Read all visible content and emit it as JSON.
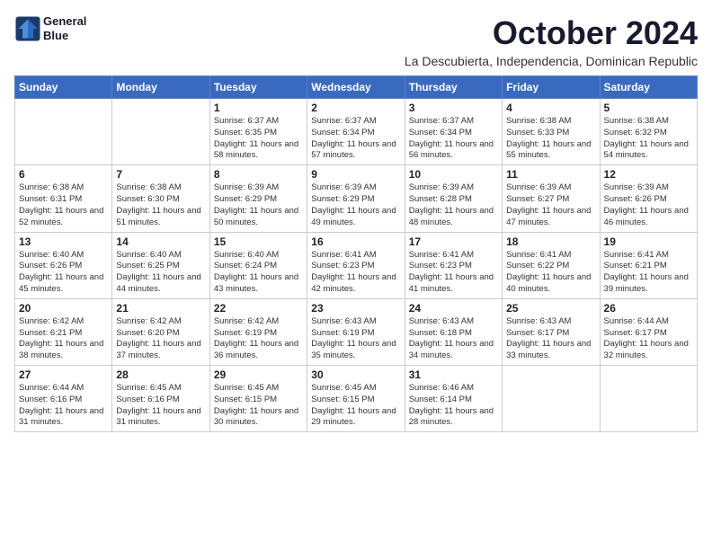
{
  "logo": {
    "line1": "General",
    "line2": "Blue"
  },
  "title": "October 2024",
  "location": "La Descubierta, Independencia, Dominican Republic",
  "weekdays": [
    "Sunday",
    "Monday",
    "Tuesday",
    "Wednesday",
    "Thursday",
    "Friday",
    "Saturday"
  ],
  "weeks": [
    [
      {
        "day": "",
        "sunrise": "",
        "sunset": "",
        "daylight": ""
      },
      {
        "day": "",
        "sunrise": "",
        "sunset": "",
        "daylight": ""
      },
      {
        "day": "1",
        "sunrise": "Sunrise: 6:37 AM",
        "sunset": "Sunset: 6:35 PM",
        "daylight": "Daylight: 11 hours and 58 minutes."
      },
      {
        "day": "2",
        "sunrise": "Sunrise: 6:37 AM",
        "sunset": "Sunset: 6:34 PM",
        "daylight": "Daylight: 11 hours and 57 minutes."
      },
      {
        "day": "3",
        "sunrise": "Sunrise: 6:37 AM",
        "sunset": "Sunset: 6:34 PM",
        "daylight": "Daylight: 11 hours and 56 minutes."
      },
      {
        "day": "4",
        "sunrise": "Sunrise: 6:38 AM",
        "sunset": "Sunset: 6:33 PM",
        "daylight": "Daylight: 11 hours and 55 minutes."
      },
      {
        "day": "5",
        "sunrise": "Sunrise: 6:38 AM",
        "sunset": "Sunset: 6:32 PM",
        "daylight": "Daylight: 11 hours and 54 minutes."
      }
    ],
    [
      {
        "day": "6",
        "sunrise": "Sunrise: 6:38 AM",
        "sunset": "Sunset: 6:31 PM",
        "daylight": "Daylight: 11 hours and 52 minutes."
      },
      {
        "day": "7",
        "sunrise": "Sunrise: 6:38 AM",
        "sunset": "Sunset: 6:30 PM",
        "daylight": "Daylight: 11 hours and 51 minutes."
      },
      {
        "day": "8",
        "sunrise": "Sunrise: 6:39 AM",
        "sunset": "Sunset: 6:29 PM",
        "daylight": "Daylight: 11 hours and 50 minutes."
      },
      {
        "day": "9",
        "sunrise": "Sunrise: 6:39 AM",
        "sunset": "Sunset: 6:29 PM",
        "daylight": "Daylight: 11 hours and 49 minutes."
      },
      {
        "day": "10",
        "sunrise": "Sunrise: 6:39 AM",
        "sunset": "Sunset: 6:28 PM",
        "daylight": "Daylight: 11 hours and 48 minutes."
      },
      {
        "day": "11",
        "sunrise": "Sunrise: 6:39 AM",
        "sunset": "Sunset: 6:27 PM",
        "daylight": "Daylight: 11 hours and 47 minutes."
      },
      {
        "day": "12",
        "sunrise": "Sunrise: 6:39 AM",
        "sunset": "Sunset: 6:26 PM",
        "daylight": "Daylight: 11 hours and 46 minutes."
      }
    ],
    [
      {
        "day": "13",
        "sunrise": "Sunrise: 6:40 AM",
        "sunset": "Sunset: 6:26 PM",
        "daylight": "Daylight: 11 hours and 45 minutes."
      },
      {
        "day": "14",
        "sunrise": "Sunrise: 6:40 AM",
        "sunset": "Sunset: 6:25 PM",
        "daylight": "Daylight: 11 hours and 44 minutes."
      },
      {
        "day": "15",
        "sunrise": "Sunrise: 6:40 AM",
        "sunset": "Sunset: 6:24 PM",
        "daylight": "Daylight: 11 hours and 43 minutes."
      },
      {
        "day": "16",
        "sunrise": "Sunrise: 6:41 AM",
        "sunset": "Sunset: 6:23 PM",
        "daylight": "Daylight: 11 hours and 42 minutes."
      },
      {
        "day": "17",
        "sunrise": "Sunrise: 6:41 AM",
        "sunset": "Sunset: 6:23 PM",
        "daylight": "Daylight: 11 hours and 41 minutes."
      },
      {
        "day": "18",
        "sunrise": "Sunrise: 6:41 AM",
        "sunset": "Sunset: 6:22 PM",
        "daylight": "Daylight: 11 hours and 40 minutes."
      },
      {
        "day": "19",
        "sunrise": "Sunrise: 6:41 AM",
        "sunset": "Sunset: 6:21 PM",
        "daylight": "Daylight: 11 hours and 39 minutes."
      }
    ],
    [
      {
        "day": "20",
        "sunrise": "Sunrise: 6:42 AM",
        "sunset": "Sunset: 6:21 PM",
        "daylight": "Daylight: 11 hours and 38 minutes."
      },
      {
        "day": "21",
        "sunrise": "Sunrise: 6:42 AM",
        "sunset": "Sunset: 6:20 PM",
        "daylight": "Daylight: 11 hours and 37 minutes."
      },
      {
        "day": "22",
        "sunrise": "Sunrise: 6:42 AM",
        "sunset": "Sunset: 6:19 PM",
        "daylight": "Daylight: 11 hours and 36 minutes."
      },
      {
        "day": "23",
        "sunrise": "Sunrise: 6:43 AM",
        "sunset": "Sunset: 6:19 PM",
        "daylight": "Daylight: 11 hours and 35 minutes."
      },
      {
        "day": "24",
        "sunrise": "Sunrise: 6:43 AM",
        "sunset": "Sunset: 6:18 PM",
        "daylight": "Daylight: 11 hours and 34 minutes."
      },
      {
        "day": "25",
        "sunrise": "Sunrise: 6:43 AM",
        "sunset": "Sunset: 6:17 PM",
        "daylight": "Daylight: 11 hours and 33 minutes."
      },
      {
        "day": "26",
        "sunrise": "Sunrise: 6:44 AM",
        "sunset": "Sunset: 6:17 PM",
        "daylight": "Daylight: 11 hours and 32 minutes."
      }
    ],
    [
      {
        "day": "27",
        "sunrise": "Sunrise: 6:44 AM",
        "sunset": "Sunset: 6:16 PM",
        "daylight": "Daylight: 11 hours and 31 minutes."
      },
      {
        "day": "28",
        "sunrise": "Sunrise: 6:45 AM",
        "sunset": "Sunset: 6:16 PM",
        "daylight": "Daylight: 11 hours and 31 minutes."
      },
      {
        "day": "29",
        "sunrise": "Sunrise: 6:45 AM",
        "sunset": "Sunset: 6:15 PM",
        "daylight": "Daylight: 11 hours and 30 minutes."
      },
      {
        "day": "30",
        "sunrise": "Sunrise: 6:45 AM",
        "sunset": "Sunset: 6:15 PM",
        "daylight": "Daylight: 11 hours and 29 minutes."
      },
      {
        "day": "31",
        "sunrise": "Sunrise: 6:46 AM",
        "sunset": "Sunset: 6:14 PM",
        "daylight": "Daylight: 11 hours and 28 minutes."
      },
      {
        "day": "",
        "sunrise": "",
        "sunset": "",
        "daylight": ""
      },
      {
        "day": "",
        "sunrise": "",
        "sunset": "",
        "daylight": ""
      }
    ]
  ]
}
